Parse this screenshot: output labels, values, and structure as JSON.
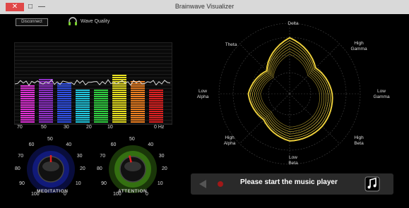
{
  "window": {
    "title": "Brainwave Visualizer",
    "close": "✕",
    "maximize": "□",
    "minimize": "—"
  },
  "toolbar": {
    "disconnect_label": "Disconnect",
    "wave_quality_label": "Wave Quality"
  },
  "spectrum": {
    "freq_labels": [
      "70",
      "50",
      "30",
      "20",
      "10",
      "0 Hz"
    ],
    "bars": [
      {
        "color": "#e030d8",
        "level": 0.48
      },
      {
        "color": "#9030c8",
        "level": 0.55
      },
      {
        "color": "#3050e8",
        "level": 0.5
      },
      {
        "color": "#20c8e0",
        "level": 0.42
      },
      {
        "color": "#30d040",
        "level": 0.42
      },
      {
        "color": "#e8e020",
        "level": 0.6
      },
      {
        "color": "#f08020",
        "level": 0.52
      },
      {
        "color": "#e02020",
        "level": 0.42
      }
    ]
  },
  "meditation": {
    "label": "MEDITATION",
    "dial_numbers": [
      "50",
      "40",
      "60",
      "30",
      "70",
      "20",
      "80",
      "10",
      "90",
      "0",
      "100"
    ],
    "level": 0.5,
    "accent": "#2233ee"
  },
  "attention": {
    "label": "ATTENTION",
    "dial_numbers": [
      "50",
      "40",
      "60",
      "30",
      "70",
      "20",
      "80",
      "10",
      "90",
      "0",
      "100"
    ],
    "level": 0.45,
    "accent": "#66dd22"
  },
  "radar": {
    "labels": {
      "top": "Delta",
      "upper_left": "Theta",
      "upper_right": "High\nGamma",
      "left": "Low\nAlpha",
      "right": "Low\nGamma",
      "lower_left": "High\nAlpha",
      "lower_right": "High\nBeta",
      "bottom": "Low\nBeta"
    },
    "trace_color": "#ffe040"
  },
  "player": {
    "message": "Please start the music player"
  }
}
